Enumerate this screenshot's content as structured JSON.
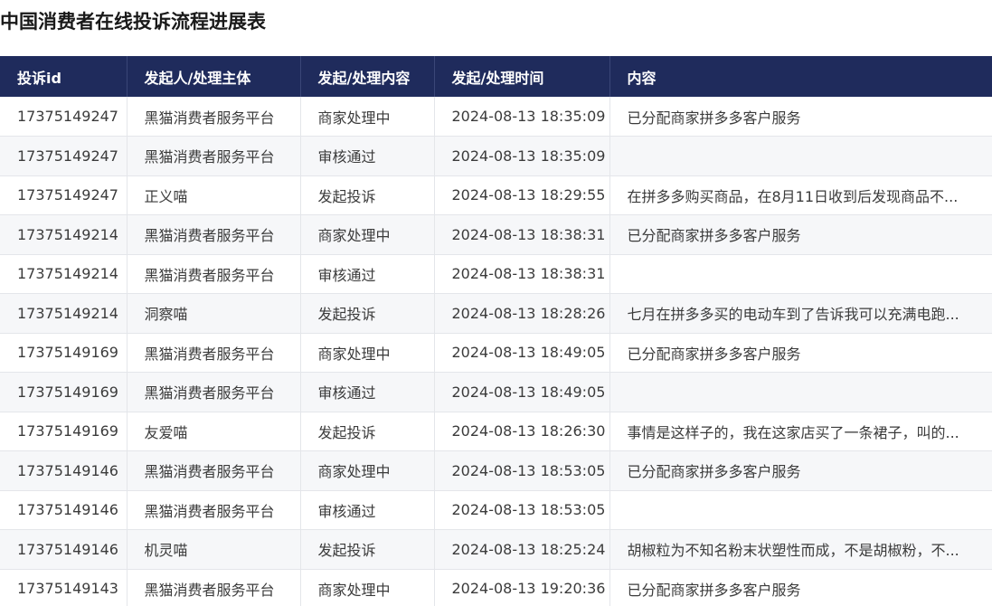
{
  "title": "中国消费者在线投诉流程进展表",
  "columns": [
    "投诉id",
    "发起人/处理主体",
    "发起/处理内容",
    "发起/处理时间",
    "内容"
  ],
  "rows": [
    {
      "id": "17375149247",
      "actor": "黑猫消费者服务平台",
      "action": "商家处理中",
      "time": "2024-08-13 18:35:09",
      "content": "已分配商家拼多多客户服务"
    },
    {
      "id": "17375149247",
      "actor": "黑猫消费者服务平台",
      "action": "审核通过",
      "time": "2024-08-13 18:35:09",
      "content": ""
    },
    {
      "id": "17375149247",
      "actor": "正义喵",
      "action": "发起投诉",
      "time": "2024-08-13 18:29:55",
      "content": "在拼多多购买商品，在8月11日收到后发现商品不..."
    },
    {
      "id": "17375149214",
      "actor": "黑猫消费者服务平台",
      "action": "商家处理中",
      "time": "2024-08-13 18:38:31",
      "content": "已分配商家拼多多客户服务"
    },
    {
      "id": "17375149214",
      "actor": "黑猫消费者服务平台",
      "action": "审核通过",
      "time": "2024-08-13 18:38:31",
      "content": ""
    },
    {
      "id": "17375149214",
      "actor": "洞察喵",
      "action": "发起投诉",
      "time": "2024-08-13 18:28:26",
      "content": "七月在拼多多买的电动车到了告诉我可以充满电跑..."
    },
    {
      "id": "17375149169",
      "actor": "黑猫消费者服务平台",
      "action": "商家处理中",
      "time": "2024-08-13 18:49:05",
      "content": "已分配商家拼多多客户服务"
    },
    {
      "id": "17375149169",
      "actor": "黑猫消费者服务平台",
      "action": "审核通过",
      "time": "2024-08-13 18:49:05",
      "content": ""
    },
    {
      "id": "17375149169",
      "actor": "友爱喵",
      "action": "发起投诉",
      "time": "2024-08-13 18:26:30",
      "content": "事情是这样子的，我在这家店买了一条裙子，叫的..."
    },
    {
      "id": "17375149146",
      "actor": "黑猫消费者服务平台",
      "action": "商家处理中",
      "time": "2024-08-13 18:53:05",
      "content": "已分配商家拼多多客户服务"
    },
    {
      "id": "17375149146",
      "actor": "黑猫消费者服务平台",
      "action": "审核通过",
      "time": "2024-08-13 18:53:05",
      "content": ""
    },
    {
      "id": "17375149146",
      "actor": "机灵喵",
      "action": "发起投诉",
      "time": "2024-08-13 18:25:24",
      "content": "胡椒粒为不知名粉末状塑性而成，不是胡椒粉，不..."
    },
    {
      "id": "17375149143",
      "actor": "黑猫消费者服务平台",
      "action": "商家处理中",
      "time": "2024-08-13 19:20:36",
      "content": "已分配商家拼多多客户服务"
    }
  ]
}
